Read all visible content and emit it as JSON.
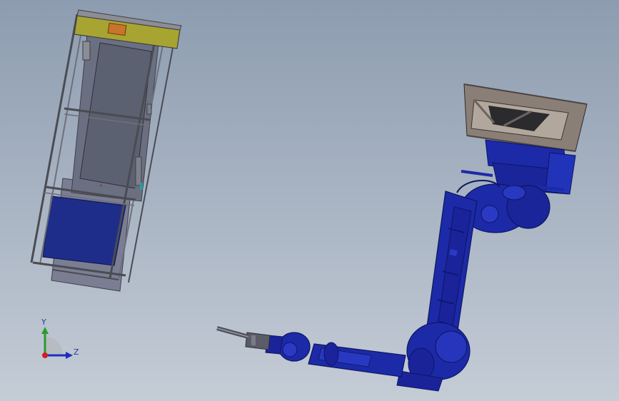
{
  "viewport": {
    "background_top": "#8d9cb0",
    "background_bottom": "#c4ccd6"
  },
  "model": {
    "cabinet": {
      "frame_color": "#5e6168",
      "top_plate_color": "#a8a431",
      "panel_color": "#5b6170",
      "base_color": "#1f2d8a",
      "indicator_color": "#c8742a"
    },
    "robot": {
      "body_color": "#1c2aa8",
      "shadow_color": "#0d1660",
      "mount_color": "#9c8c7c"
    }
  },
  "triad": {
    "y_label": "Y",
    "z_label": "Z",
    "y_color": "#2a9c2a",
    "z_color": "#1f2dbd",
    "origin_color": "#d0201c",
    "label_color": "#2c3a9e"
  }
}
